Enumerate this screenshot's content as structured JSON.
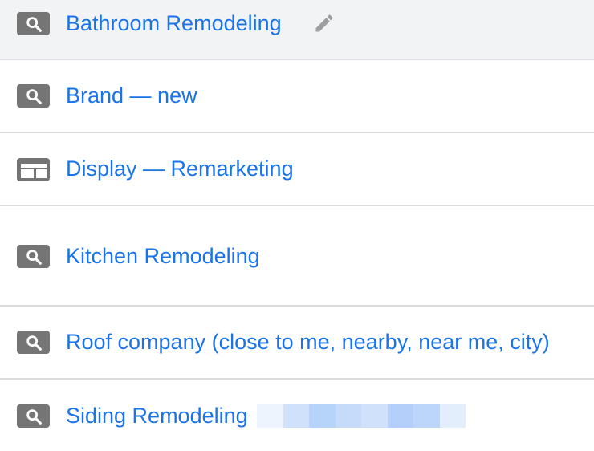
{
  "campaigns": [
    {
      "name": "Bathroom Remodeling",
      "type_icon": "search-icon",
      "hovered": true,
      "editable": true
    },
    {
      "name": "Brand — new",
      "type_icon": "search-icon"
    },
    {
      "name": "Display — Remarketing",
      "type_icon": "display-icon"
    },
    {
      "name": "Kitchen Remodeling",
      "type_icon": "search-icon"
    },
    {
      "name": "Roof company (close to me, nearby, near me, city)",
      "type_icon": "search-icon"
    },
    {
      "name": "Siding Remodeling",
      "type_icon": "search-icon",
      "redacted_suffix": true
    }
  ],
  "colors": {
    "link": "#1a73e8",
    "icon_bg": "#757575",
    "divider": "#dadce0",
    "hover_row": "#f1f3f4",
    "edit_icon": "#9e9e9e"
  },
  "icons": {
    "edit": "pencil-icon"
  }
}
